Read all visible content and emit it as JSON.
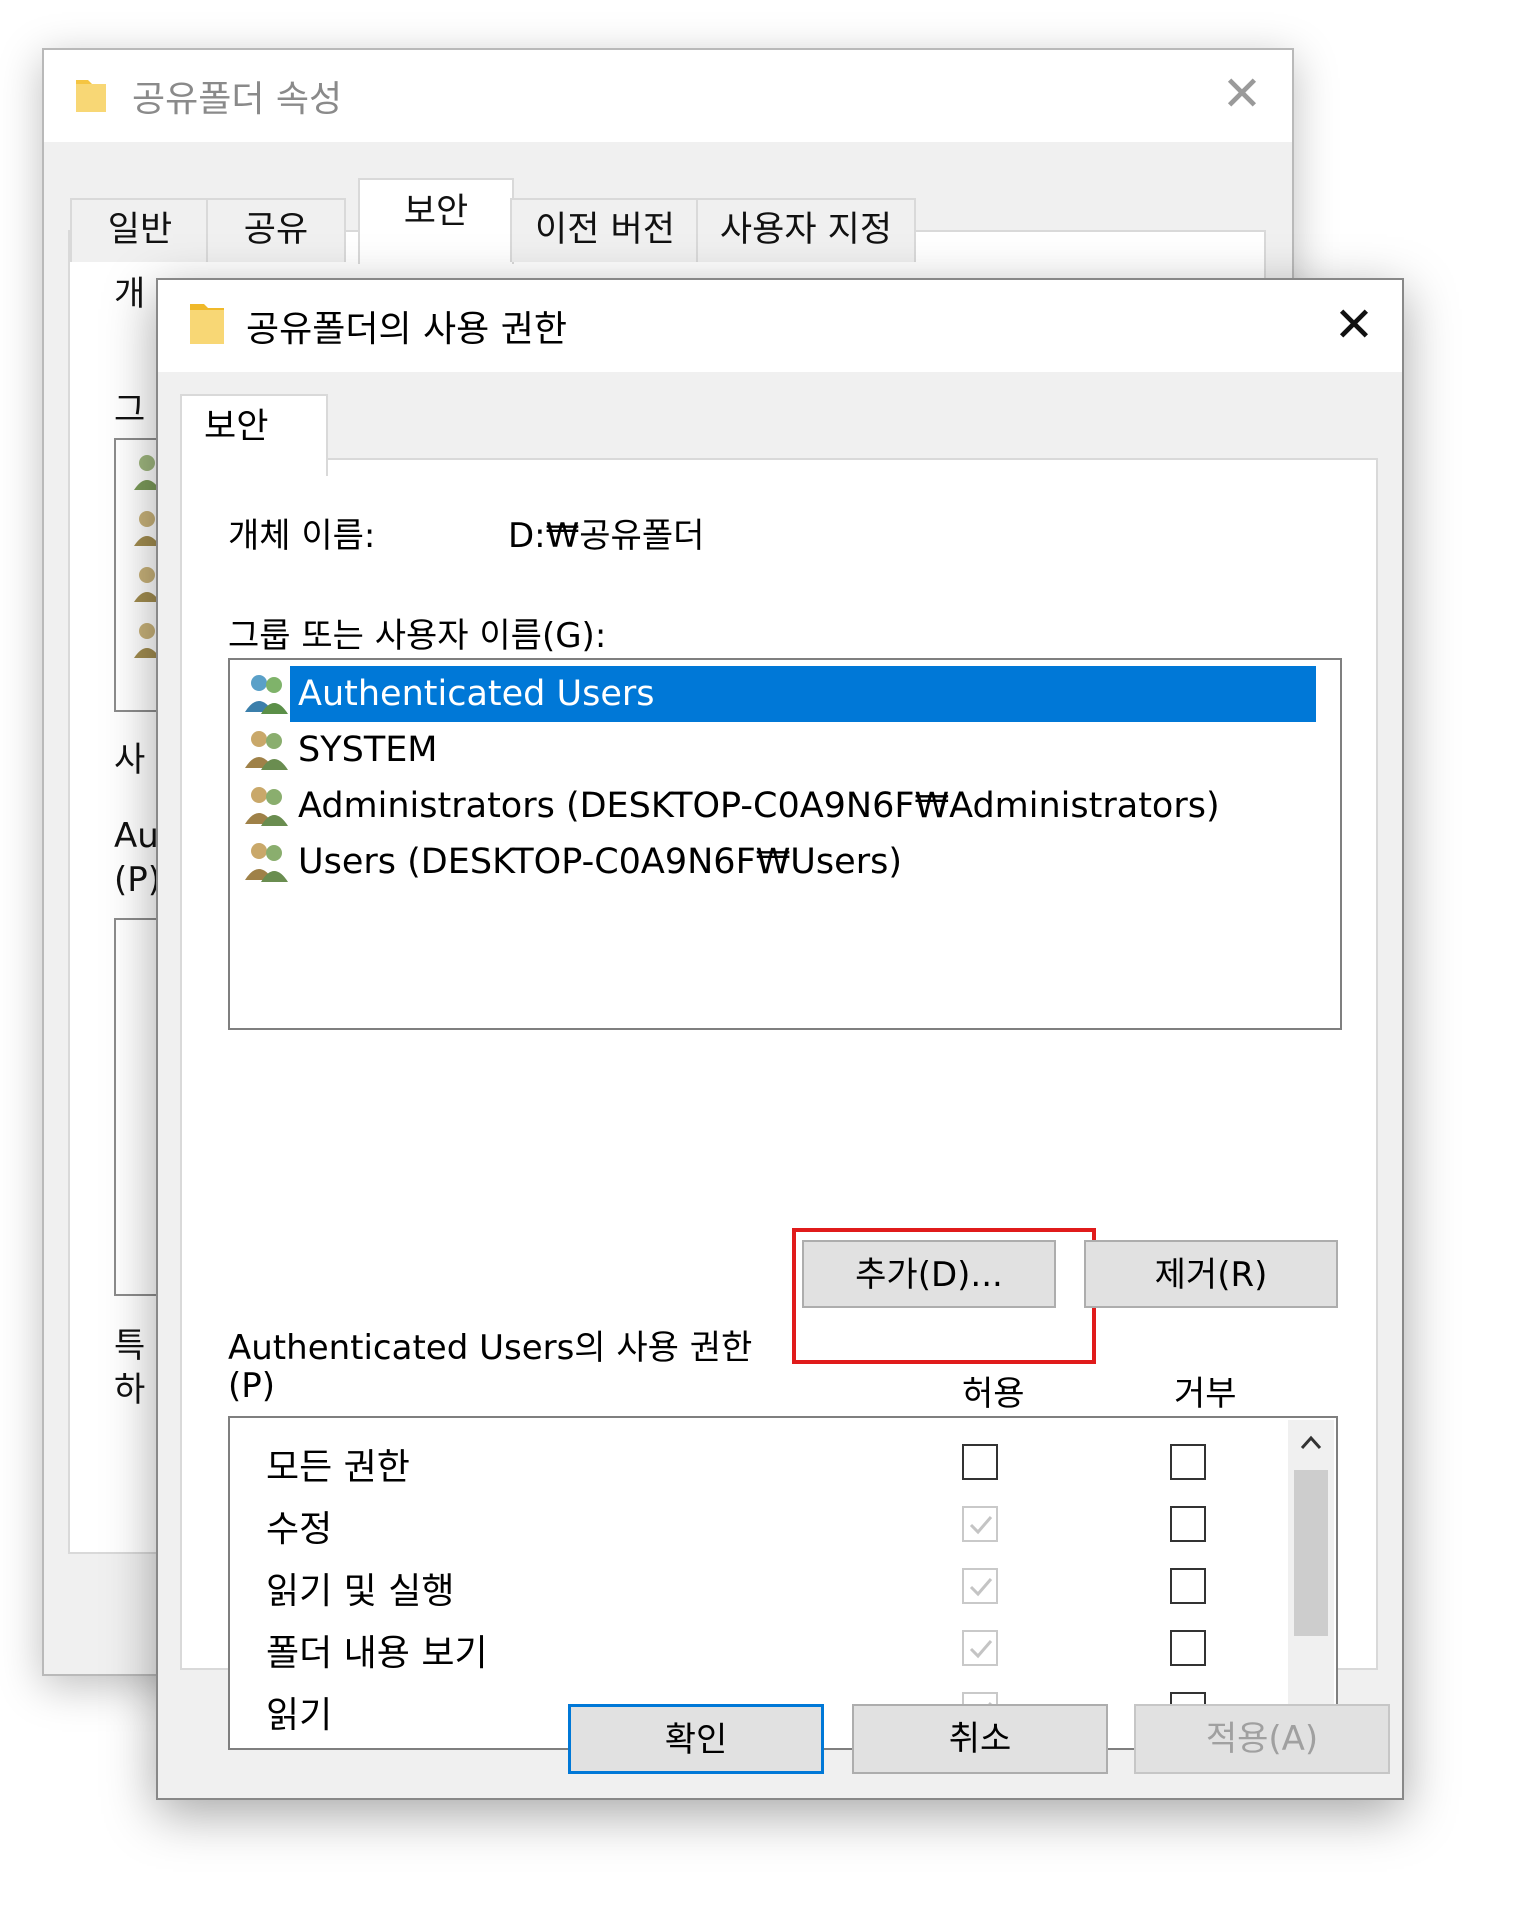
{
  "back_window": {
    "title": "공유폴더 속성",
    "tabs": [
      "일반",
      "공유",
      "보안",
      "이전 버전",
      "사용자 지정"
    ],
    "active_tab": "보안",
    "fragments": [
      "개",
      "그",
      "사",
      "Au",
      "(P)",
      "특",
      "하"
    ]
  },
  "dialog": {
    "title": "공유폴더의 사용 권한",
    "tab": "보안",
    "object_name_label": "개체 이름:",
    "object_name_value": "D:₩공유폴더",
    "group_label": "그룹 또는 사용자 이름(G):",
    "users": [
      {
        "name": "Authenticated Users",
        "selected": true
      },
      {
        "name": "SYSTEM",
        "selected": false
      },
      {
        "name": "Administrators (DESKTOP-C0A9N6F₩Administrators)",
        "selected": false
      },
      {
        "name": "Users (DESKTOP-C0A9N6F₩Users)",
        "selected": false
      }
    ],
    "add_button": "추가(D)...",
    "remove_button": "제거(R)",
    "permissions_label_line1": "Authenticated Users의 사용 권한",
    "permissions_label_line2": "(P)",
    "allow_header": "허용",
    "deny_header": "거부",
    "permissions": [
      {
        "name": "모든 권한",
        "allow": false,
        "allow_disabled": false,
        "deny": false
      },
      {
        "name": "수정",
        "allow": true,
        "allow_disabled": true,
        "deny": false
      },
      {
        "name": "읽기 및 실행",
        "allow": true,
        "allow_disabled": true,
        "deny": false
      },
      {
        "name": "폴더 내용 보기",
        "allow": true,
        "allow_disabled": true,
        "deny": false
      },
      {
        "name": "읽기",
        "allow": true,
        "allow_disabled": true,
        "deny": false
      }
    ],
    "ok_button": "확인",
    "cancel_button": "취소",
    "apply_button": "적용(A)"
  },
  "colors": {
    "selection": "#0078d7",
    "highlight_box": "#e01b1b",
    "folder": "#f5c542"
  },
  "icons": {
    "folder": "folder-icon",
    "close": "close-icon",
    "user_group": "user-group-icon",
    "scroll_up": "chevron-up-icon",
    "scroll_down": "chevron-down-icon",
    "check": "check-icon"
  }
}
